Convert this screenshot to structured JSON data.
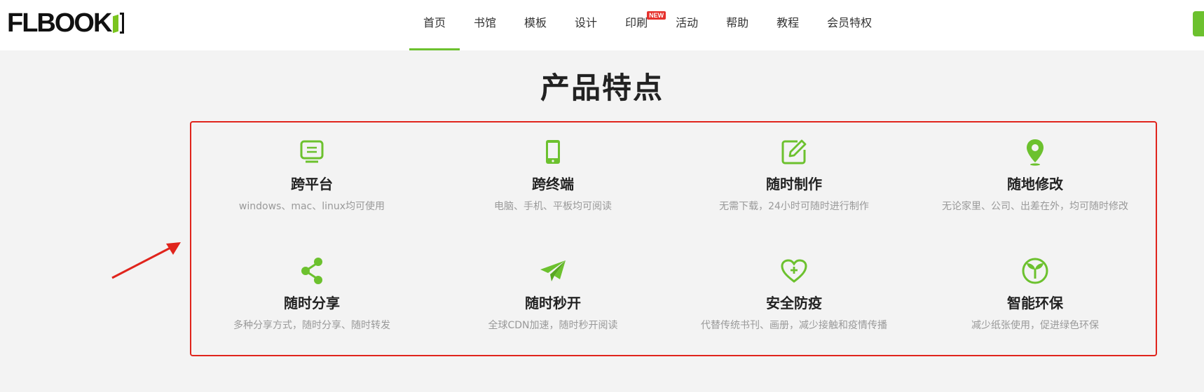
{
  "header": {
    "logo_text": "FLBOOK",
    "nav": [
      {
        "label": "首页",
        "active": true
      },
      {
        "label": "书馆"
      },
      {
        "label": "模板"
      },
      {
        "label": "设计"
      },
      {
        "label": "印刷",
        "badge": "NEW"
      },
      {
        "label": "活动"
      },
      {
        "label": "帮助"
      },
      {
        "label": "教程"
      },
      {
        "label": "会员特权"
      }
    ]
  },
  "main": {
    "title": "产品特点",
    "features": [
      {
        "icon": "monitor-icon",
        "title": "跨平台",
        "desc": "windows、mac、linux均可使用"
      },
      {
        "icon": "phone-icon",
        "title": "跨终端",
        "desc": "电脑、手机、平板均可阅读"
      },
      {
        "icon": "edit-icon",
        "title": "随时制作",
        "desc": "无需下载，24小时可随时进行制作"
      },
      {
        "icon": "location-pin-icon",
        "title": "随地修改",
        "desc": "无论家里、公司、出差在外，均可随时修改"
      },
      {
        "icon": "share-icon",
        "title": "随时分享",
        "desc": "多种分享方式，随时分享、随时转发"
      },
      {
        "icon": "paper-plane-icon",
        "title": "随时秒开",
        "desc": "全球CDN加速，随时秒开阅读"
      },
      {
        "icon": "heart-plus-icon",
        "title": "安全防疫",
        "desc": "代替传统书刊、画册，减少接触和疫情传播"
      },
      {
        "icon": "eco-leaf-icon",
        "title": "智能环保",
        "desc": "减少纸张使用，促进绿色环保"
      }
    ]
  },
  "colors": {
    "accent": "#6cc12e",
    "highlight_box": "#e0241c",
    "badge": "#e6322e"
  }
}
